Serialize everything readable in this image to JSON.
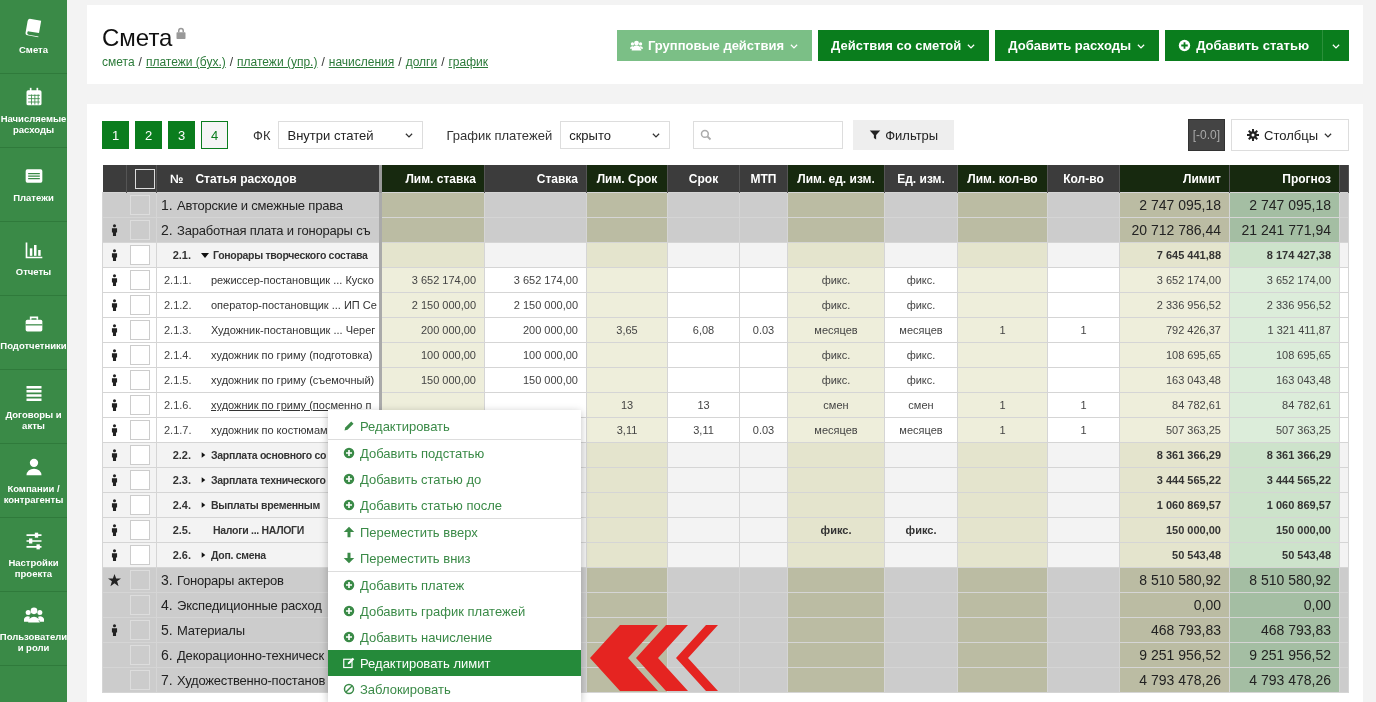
{
  "sidebar": {
    "items": [
      {
        "label": "Смета"
      },
      {
        "label": "Начисляемые расходы"
      },
      {
        "label": "Платежи"
      },
      {
        "label": "Отчеты"
      },
      {
        "label": "Подотчетники"
      },
      {
        "label": "Договоры и акты"
      },
      {
        "label": "Компании / контрагенты"
      },
      {
        "label": "Настройки проекта"
      },
      {
        "label": "Пользователи и роли"
      }
    ]
  },
  "header": {
    "title": "Смета",
    "locked": true,
    "breadcrumbs": [
      {
        "label": "смета",
        "link": false
      },
      {
        "separator": "/",
        "label": "платежи (бух.)",
        "link": true
      },
      {
        "separator": "/",
        "label": "платежи (упр.)",
        "link": true
      },
      {
        "separator": "/",
        "label": "начисления",
        "link": true
      },
      {
        "separator": "/",
        "label": "долги",
        "link": true
      },
      {
        "separator": "/",
        "label": "график",
        "link": true
      }
    ],
    "buttons": [
      {
        "label": "Групповые действия",
        "disabled": true
      },
      {
        "label": "Действия со сметой",
        "disabled": false
      },
      {
        "label": "Добавить расходы",
        "disabled": false
      },
      {
        "label": "Добавить статью",
        "disabled": false
      }
    ]
  },
  "toolbar": {
    "levels": [
      {
        "label": "1",
        "selected": false
      },
      {
        "label": "2",
        "selected": false
      },
      {
        "label": "3",
        "selected": false
      },
      {
        "label": "4",
        "selected": true
      }
    ],
    "fk": {
      "label": "ФК",
      "value": "Внутри статей"
    },
    "schedule": {
      "label": "График платежей",
      "value": "скрыто"
    },
    "filters": "Фильтры",
    "badge": "[-0.0]",
    "columns": "Столбцы"
  },
  "table": {
    "select_all": {
      "checked": false
    },
    "columns": [
      "№",
      "Статья расходов",
      "Лим. ставка",
      "Ставка",
      "Лим. Срок",
      "Срок",
      "МТП",
      "Лим. ед. изм.",
      "Ед. изм.",
      "Лим. кол-во",
      "Кол-во",
      "Лимит",
      "Прогноз"
    ],
    "rows": [
      {
        "kind": "top",
        "responsible": false,
        "favorite": false,
        "checked": false,
        "hovered": false,
        "cells": [
          "1.",
          "Авторские и смежные права",
          null,
          null,
          null,
          null,
          null,
          null,
          null,
          null,
          null,
          "2 747 095,18",
          "2 747 095,18"
        ]
      },
      {
        "kind": "top",
        "responsible": true,
        "favorite": false,
        "checked": false,
        "hovered": false,
        "cells": [
          "2.",
          "Заработная плата и гонорары съ",
          null,
          null,
          null,
          null,
          null,
          null,
          null,
          null,
          null,
          "20 712 786,44",
          "21 241 771,94"
        ]
      },
      {
        "kind": "group",
        "responsible": true,
        "favorite": false,
        "expanded": true,
        "checked": false,
        "hovered": false,
        "cells": [
          "2.1.",
          "Гонорары творческого состава",
          null,
          null,
          null,
          null,
          null,
          null,
          null,
          null,
          null,
          "7 645 441,88",
          "8 174 427,38"
        ]
      },
      {
        "kind": "item",
        "responsible": true,
        "favorite": false,
        "checked": false,
        "hovered": false,
        "cells": [
          "2.1.1.",
          "режиссер-постановщик ... Куско",
          "3 652 174,00",
          "3 652 174,00",
          null,
          null,
          null,
          "фикс.",
          "фикс.",
          null,
          null,
          "3 652 174,00",
          "3 652 174,00"
        ]
      },
      {
        "kind": "item",
        "responsible": true,
        "favorite": false,
        "checked": false,
        "hovered": false,
        "cells": [
          "2.1.2.",
          "оператор-постановщик ... ИП Се",
          "2 150 000,00",
          "2 150 000,00",
          null,
          null,
          null,
          "фикс.",
          "фикс.",
          null,
          null,
          "2 336 956,52",
          "2 336 956,52"
        ]
      },
      {
        "kind": "item",
        "responsible": true,
        "favorite": false,
        "checked": false,
        "hovered": false,
        "cells": [
          "2.1.3.",
          "Художник-постановщик ... Черег",
          "200 000,00",
          "200 000,00",
          "3,65",
          "6,08",
          "0.03",
          "месяцев",
          "месяцев",
          "1",
          "1",
          "792 426,37",
          "1 321 411,87"
        ]
      },
      {
        "kind": "item",
        "responsible": true,
        "favorite": false,
        "checked": false,
        "hovered": false,
        "cells": [
          "2.1.4.",
          "художник по гриму (подготовка)",
          "100 000,00",
          "100 000,00",
          null,
          null,
          null,
          "фикс.",
          "фикс.",
          null,
          null,
          "108 695,65",
          "108 695,65"
        ]
      },
      {
        "kind": "item",
        "responsible": true,
        "favorite": false,
        "checked": false,
        "hovered": false,
        "cells": [
          "2.1.5.",
          "художник по гриму (съемочный)",
          "150 000,00",
          "150 000,00",
          null,
          null,
          null,
          "фикс.",
          "фикс.",
          null,
          null,
          "163 043,48",
          "163 043,48"
        ]
      },
      {
        "kind": "item",
        "responsible": true,
        "favorite": false,
        "checked": false,
        "hovered": true,
        "cells": [
          "2.1.6.",
          "художник по гриму (посменно п",
          null,
          null,
          "13",
          "13",
          null,
          "смен",
          "смен",
          "1",
          "1",
          "84 782,61",
          "84 782,61"
        ]
      },
      {
        "kind": "item",
        "responsible": true,
        "favorite": false,
        "checked": false,
        "hovered": false,
        "cells": [
          "2.1.7.",
          "художник по костюмам",
          null,
          null,
          "3,11",
          "3,11",
          "0.03",
          "месяцев",
          "месяцев",
          "1",
          "1",
          "507 363,25",
          "507 363,25"
        ]
      },
      {
        "kind": "group",
        "responsible": true,
        "favorite": false,
        "expanded": false,
        "checked": false,
        "hovered": false,
        "cells": [
          "2.2.",
          "Зарплата основного со",
          null,
          null,
          null,
          null,
          null,
          null,
          null,
          null,
          null,
          "8 361 366,29",
          "8 361 366,29"
        ]
      },
      {
        "kind": "group",
        "responsible": true,
        "favorite": false,
        "expanded": false,
        "checked": false,
        "hovered": false,
        "cells": [
          "2.3.",
          "Зарплата технического",
          null,
          null,
          null,
          null,
          null,
          null,
          null,
          null,
          null,
          "3 444 565,22",
          "3 444 565,22"
        ]
      },
      {
        "kind": "group",
        "responsible": true,
        "favorite": false,
        "expanded": false,
        "checked": false,
        "hovered": false,
        "cells": [
          "2.4.",
          "Выплаты временным",
          null,
          null,
          null,
          null,
          null,
          null,
          null,
          null,
          null,
          "1 060 869,57",
          "1 060 869,57"
        ]
      },
      {
        "kind": "group",
        "responsible": true,
        "favorite": false,
        "checked": false,
        "hovered": false,
        "cells": [
          "2.5.",
          "Налоги ... НАЛОГИ",
          null,
          null,
          null,
          null,
          null,
          "фикс.",
          "фикс.",
          null,
          null,
          "150 000,00",
          "150 000,00"
        ]
      },
      {
        "kind": "group",
        "responsible": true,
        "favorite": false,
        "expanded": false,
        "checked": false,
        "hovered": false,
        "cells": [
          "2.6.",
          "Доп. смена",
          null,
          null,
          null,
          null,
          null,
          null,
          null,
          null,
          null,
          "50 543,48",
          "50 543,48"
        ]
      },
      {
        "kind": "top",
        "responsible": false,
        "favorite": true,
        "checked": false,
        "hovered": false,
        "cells": [
          "3.",
          "Гонорары актеров",
          null,
          null,
          null,
          null,
          null,
          null,
          null,
          null,
          null,
          "8 510 580,92",
          "8 510 580,92"
        ]
      },
      {
        "kind": "top",
        "responsible": false,
        "favorite": false,
        "checked": false,
        "hovered": false,
        "cells": [
          "4.",
          "Экспедиционные расход",
          null,
          null,
          null,
          null,
          null,
          null,
          null,
          null,
          null,
          "0,00",
          "0,00"
        ]
      },
      {
        "kind": "top",
        "responsible": true,
        "favorite": false,
        "checked": false,
        "hovered": false,
        "cells": [
          "5.",
          "Материалы",
          null,
          null,
          null,
          null,
          null,
          null,
          null,
          null,
          null,
          "468 793,83",
          "468 793,83"
        ]
      },
      {
        "kind": "top",
        "responsible": false,
        "favorite": false,
        "checked": false,
        "hovered": false,
        "cells": [
          "6.",
          "Декорационно-техническ",
          null,
          null,
          null,
          null,
          null,
          null,
          null,
          null,
          null,
          "9 251 956,52",
          "9 251 956,52"
        ]
      },
      {
        "kind": "top",
        "responsible": false,
        "favorite": false,
        "checked": false,
        "hovered": false,
        "cells": [
          "7.",
          "Художественно-постанов",
          null,
          null,
          null,
          null,
          null,
          null,
          null,
          null,
          null,
          "4 793 478,26",
          "4 793 478,26"
        ]
      }
    ]
  },
  "context_menu": {
    "items": [
      {
        "label": "Редактировать",
        "separator_before": false,
        "selected": false
      },
      {
        "label": "Добавить подстатью",
        "separator_before": true,
        "selected": false
      },
      {
        "label": "Добавить статью до",
        "separator_before": false,
        "selected": false
      },
      {
        "label": "Добавить статью после",
        "separator_before": false,
        "selected": false
      },
      {
        "label": "Переместить вверх",
        "separator_before": true,
        "selected": false
      },
      {
        "label": "Переместить вниз",
        "separator_before": false,
        "selected": false
      },
      {
        "label": "Добавить платеж",
        "separator_before": true,
        "selected": false
      },
      {
        "label": "Добавить график платежей",
        "separator_before": false,
        "selected": false
      },
      {
        "label": "Добавить начисление",
        "separator_before": false,
        "selected": false
      },
      {
        "label": "Редактировать лимит",
        "separator_before": false,
        "selected": true
      },
      {
        "label": "Заблокировать",
        "separator_before": false,
        "selected": false
      }
    ]
  }
}
